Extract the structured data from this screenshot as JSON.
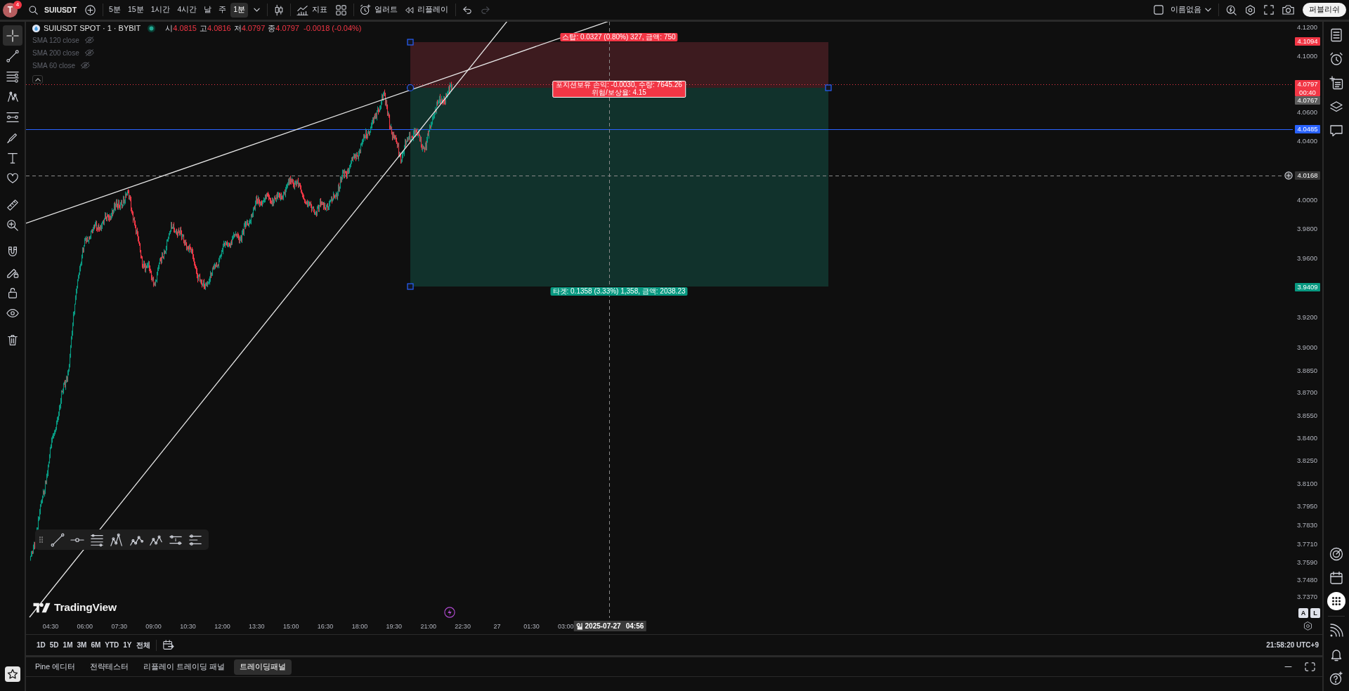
{
  "top_bar": {
    "avatar": {
      "letter": "T",
      "badge": "4"
    },
    "symbol": "SUIUSDT",
    "intervals": [
      {
        "label": "5분",
        "selected": false
      },
      {
        "label": "15분",
        "selected": false
      },
      {
        "label": "1시간",
        "selected": false
      },
      {
        "label": "4시간",
        "selected": false
      },
      {
        "label": "날",
        "selected": false
      },
      {
        "label": "주",
        "selected": false
      },
      {
        "label": "1분",
        "selected": true
      }
    ],
    "indicators_label": "지표",
    "alert_label": "얼러트",
    "replay_label": "리플레이",
    "undo": {
      "disabled": false
    },
    "redo": {
      "disabled": true
    },
    "layout_name": "이름없음",
    "publish_label": "퍼블리쉬"
  },
  "left_toolbar": {
    "tools": [
      {
        "selected": true
      },
      {
        "selected": false
      },
      {
        "selected": false
      },
      {
        "selected": false
      },
      {
        "selected": false
      },
      {
        "selected": false
      },
      {
        "selected": false
      },
      {
        "selected": false
      },
      {
        "selected": false
      },
      {
        "selected": false
      },
      {
        "selected": false
      },
      {
        "selected": false
      },
      {
        "selected": false
      },
      {
        "selected": false
      },
      {
        "selected": false
      }
    ]
  },
  "chart": {
    "legend": {
      "title": "SUIUSDT SPOT · 1 · BYBIT",
      "ohlc": [
        {
          "label": "시",
          "value": "4.0815"
        },
        {
          "label": "고",
          "value": "4.0816"
        },
        {
          "label": "저",
          "value": "4.0797"
        },
        {
          "label": "종",
          "value": "4.0797"
        }
      ],
      "change": "-0.0018 (-0.04%)"
    },
    "indicators": [
      {
        "name": "SMA 120 close",
        "visible": false
      },
      {
        "name": "SMA 200 close",
        "visible": false
      },
      {
        "name": "SMA 60 close",
        "visible": false
      }
    ],
    "position": {
      "stop_label": "스탑: 0.0327 (0.80%) 327, 금액: 750",
      "pnl_label": "포지션보유 손익: -0.0030, 수량: 7645.26",
      "ratio_label": "위험/보상율: 4.15",
      "target_label": "타겟: 0.1358 (3.33%) 1,358, 금액: 2038.23"
    },
    "logo": "TradingView",
    "price_axis": {
      "labels": [
        "4.1200",
        "4.1000",
        "4.0600",
        "4.0400",
        "4.0000",
        "3.9800",
        "3.9600",
        "3.9200",
        "3.9000",
        "3.8850",
        "3.8700",
        "3.8550",
        "3.8400",
        "3.8250",
        "3.8100",
        "3.7950",
        "3.7830",
        "3.7710",
        "3.7590",
        "3.7480",
        "3.7370"
      ],
      "tags": [
        {
          "value": "4.1094",
          "color": "#f23645"
        },
        {
          "value": "4.0797",
          "countdown": "00:40",
          "color": "#f23645"
        },
        {
          "value": "4.0767",
          "color": "#5d5d5d"
        },
        {
          "value": "4.0485",
          "color": "#2962ff"
        },
        {
          "value": "4.0168",
          "color": "#363636"
        },
        {
          "value": "3.9409",
          "color": "#089981"
        }
      ],
      "scale_buttons": [
        "A",
        "L"
      ]
    },
    "time_axis": {
      "labels": [
        "04:30",
        "06:00",
        "07:30",
        "09:00",
        "10:30",
        "12:00",
        "13:30",
        "15:00",
        "16:30",
        "18:00",
        "19:30",
        "21:00",
        "22:30",
        "27",
        "01:30",
        "03:00"
      ],
      "crosshair_date": "일 2025-07-27",
      "crosshair_time": "04:56"
    }
  },
  "range_bar": {
    "ranges": [
      "1D",
      "5D",
      "1M",
      "3M",
      "6M",
      "YTD",
      "1Y",
      "전체"
    ],
    "clock": "21:58:20 UTC+9"
  },
  "bottom_panel": {
    "tabs": [
      {
        "label": "Pine 에디터",
        "selected": false
      },
      {
        "label": "전략테스터",
        "selected": false
      },
      {
        "label": "리플레이 트레이딩 패널",
        "selected": false
      },
      {
        "label": "트레이딩패널",
        "selected": true
      }
    ]
  }
}
